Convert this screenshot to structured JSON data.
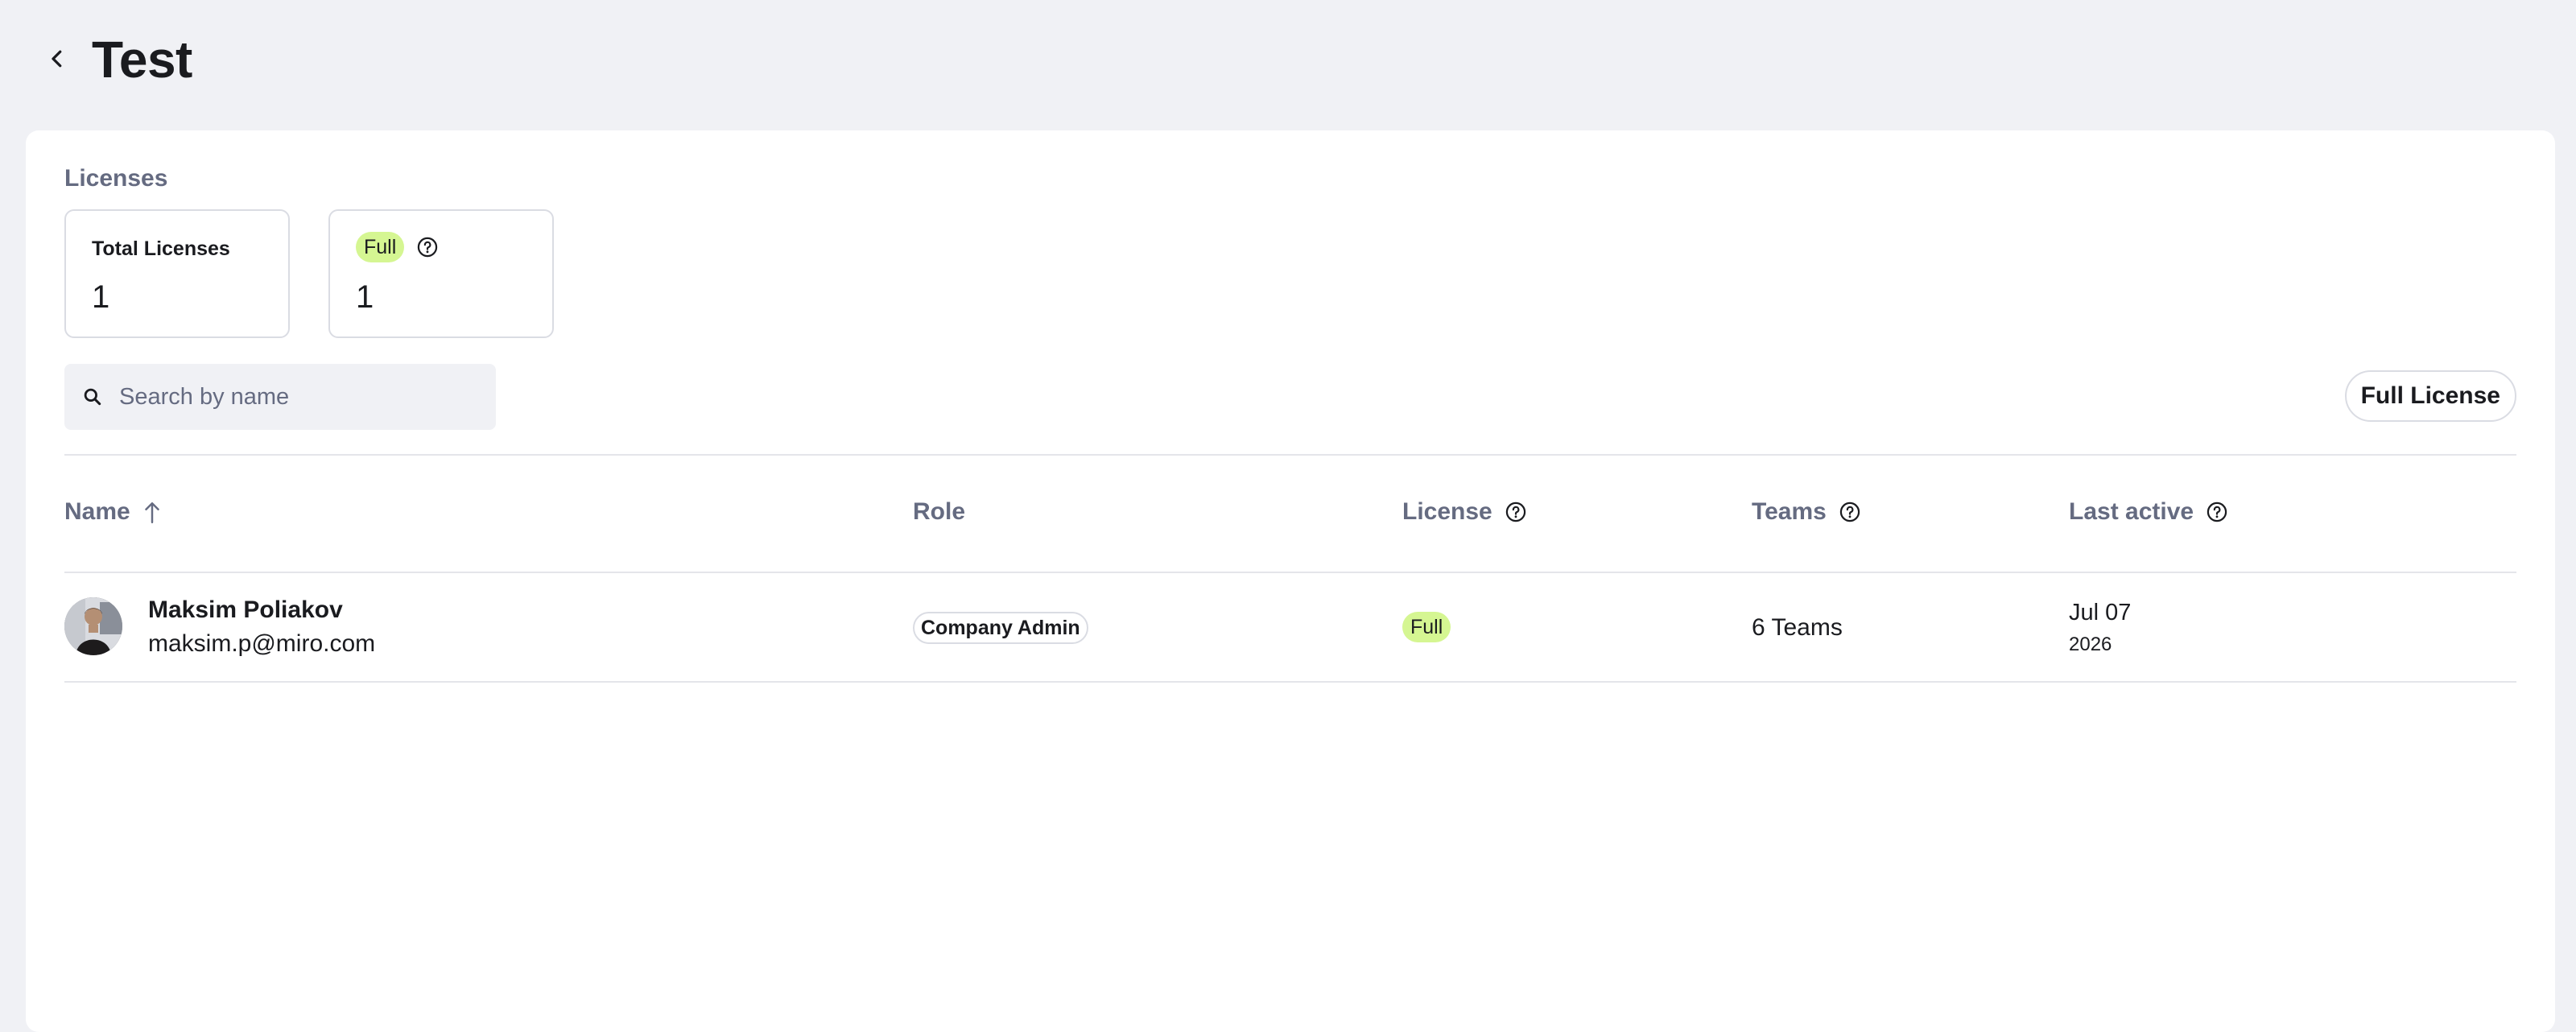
{
  "header": {
    "title": "Test"
  },
  "licenses": {
    "section_title": "Licenses",
    "total_card": {
      "label": "Total Licenses",
      "value": "1"
    },
    "full_card": {
      "label": "Full",
      "value": "1"
    }
  },
  "search": {
    "placeholder": "Search by name",
    "value": ""
  },
  "filter": {
    "label": "Full License"
  },
  "table": {
    "columns": {
      "name": "Name",
      "role": "Role",
      "license": "License",
      "teams": "Teams",
      "last_active": "Last active"
    },
    "rows": [
      {
        "name": "Maksim Poliakov",
        "email": "maksim.p@miro.com",
        "role": "Company Admin",
        "license": "Full",
        "teams": "6 Teams",
        "last_active_date": "Jul 07",
        "last_active_year": "2026"
      }
    ]
  },
  "colors": {
    "page_bg": "#f0f1f5",
    "panel_bg": "#ffffff",
    "muted_text": "#656b81",
    "full_badge": "#d5f692",
    "border": "#dadce3"
  },
  "icons": {
    "back": "chevron-left-icon",
    "help": "question-circle-icon",
    "search": "search-icon",
    "sort": "arrow-up-icon"
  }
}
